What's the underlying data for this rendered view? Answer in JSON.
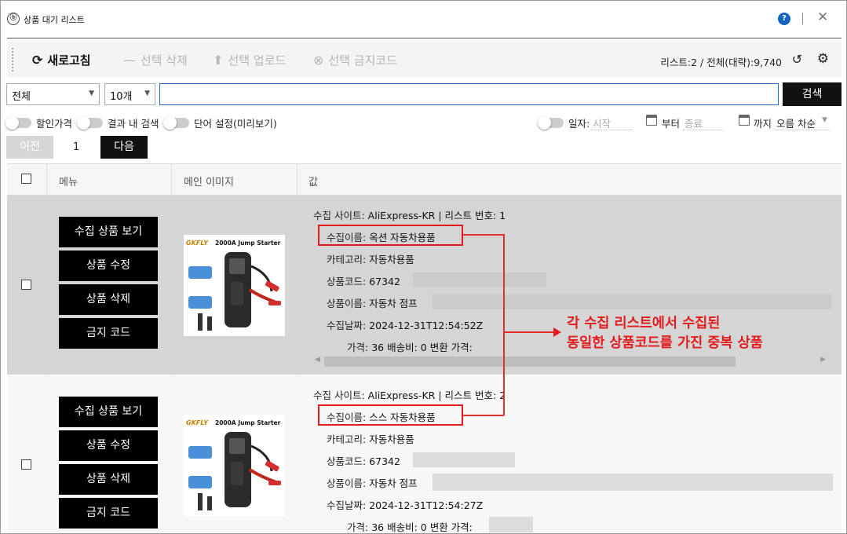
{
  "window": {
    "title": "상품 대기 리스트",
    "app_icon": "ⓑ",
    "help_icon": "?",
    "close_icon": "✕"
  },
  "toolbar": {
    "refresh_label": "새로고침",
    "delete_label": "선택 삭제",
    "upload_label": "선택 업로드",
    "ban_label": "선택 금지코드",
    "status_text": "리스트:2  /  전체(대략):9,740"
  },
  "search": {
    "category_value": "전체",
    "count_value": "10개",
    "query_value": "",
    "button_label": "검색"
  },
  "filters": {
    "discount_label": "할인가격",
    "within_results_label": "결과 내 검색",
    "word_setting_label": "단어 설정(미리보기)",
    "date_label": "일자:",
    "start_placeholder": "시작",
    "from_label": "부터",
    "end_placeholder": "종료",
    "until_label": "까지",
    "sort_value": "오름 차순"
  },
  "paging": {
    "prev_label": "이전",
    "page": "1",
    "next_label": "다음"
  },
  "table": {
    "headers": {
      "menu": "메뉴",
      "image": "메인 이미지",
      "value": "값"
    },
    "menu_buttons": [
      "수집 상품 보기",
      "상품 수정",
      "상품 삭제",
      "금지 코드"
    ],
    "thumb_brand": "GKFLY",
    "thumb_title": "2000A Jump Starter",
    "rows": [
      {
        "site_label": "수집 사이트:",
        "site_value": "AliExpress-KR | 리스트 번호: 1",
        "name_label": "수집이름:",
        "name_value": "옥션 자동차용품",
        "category_label": "카테고리:",
        "category_value": "자동차용품",
        "code_label": "상품코드:",
        "code_value": "67342",
        "product_label": "상품이름:",
        "product_value": "자동차 점프",
        "date_label": "수집날짜:",
        "date_value": "2024-12-31T12:54:52Z",
        "price_label": "가격:",
        "price_value": "36 배송비: 0  변환 가격:"
      },
      {
        "site_label": "수집 사이트:",
        "site_value": "AliExpress-KR | 리스트 번호: 2",
        "name_label": "수집이름:",
        "name_value": "스스 자동차용품",
        "category_label": "카테고리:",
        "category_value": "자동차용품",
        "code_label": "상품코드:",
        "code_value": "67342",
        "product_label": "상품이름:",
        "product_value": "자동차 점프",
        "date_label": "수집날짜:",
        "date_value": "2024-12-31T12:54:27Z",
        "price_label": "가격:",
        "price_value": "36 배송비: 0  변환 가격:"
      }
    ]
  },
  "annotation": {
    "line1": "각 수집 리스트에서 수집된",
    "line2": "동일한 상품코드를 가진 중복 상품"
  }
}
